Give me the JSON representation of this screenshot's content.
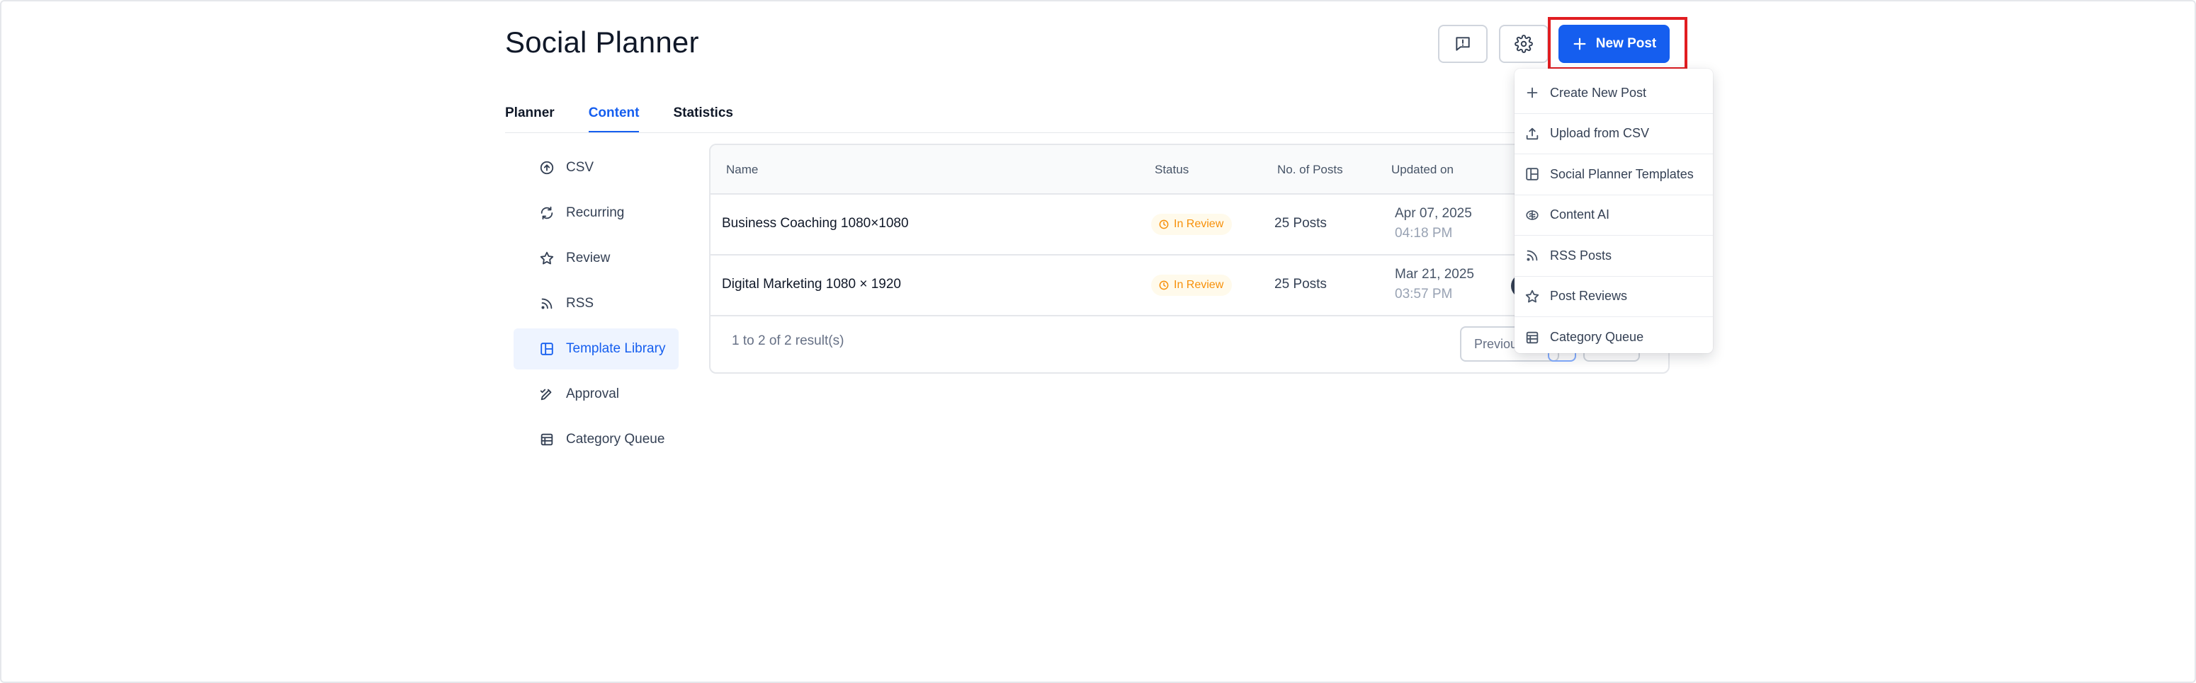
{
  "page": {
    "title": "Social Planner"
  },
  "header": {
    "new_post_label": "New Post"
  },
  "tabs": [
    {
      "label": "Planner"
    },
    {
      "label": "Content",
      "active": true
    },
    {
      "label": "Statistics"
    }
  ],
  "sidebar": {
    "items": [
      {
        "label": "CSV",
        "icon": "upload-circle-icon"
      },
      {
        "label": "Recurring",
        "icon": "refresh-icon"
      },
      {
        "label": "Review",
        "icon": "star-icon"
      },
      {
        "label": "RSS",
        "icon": "rss-icon"
      },
      {
        "label": "Template Library",
        "icon": "layout-icon",
        "active": true
      },
      {
        "label": "Approval",
        "icon": "pen-check-icon"
      },
      {
        "label": "Category Queue",
        "icon": "calendar-grid-icon"
      }
    ]
  },
  "table": {
    "columns": [
      "Name",
      "Status",
      "No. of Posts",
      "Updated on"
    ],
    "rows": [
      {
        "name": "Business Coaching 1080×1080",
        "status": "In Review",
        "posts": "25 Posts",
        "date": "Apr 07, 2025",
        "time": "04:18 PM"
      },
      {
        "name": "Digital Marketing 1080 × 1920",
        "status": "In Review",
        "posts": "25 Posts",
        "date": "Mar 21, 2025",
        "time": "03:57 PM"
      }
    ],
    "results_text": "1 to 2 of 2 result(s)",
    "previous_label": "Previous"
  },
  "dropdown": {
    "items": [
      {
        "label": "Create New Post",
        "icon": "plus-icon"
      },
      {
        "label": "Upload from CSV",
        "icon": "upload-icon"
      },
      {
        "label": "Social Planner Templates",
        "icon": "layout-icon"
      },
      {
        "label": "Content AI",
        "icon": "ai-brain-icon"
      },
      {
        "label": "RSS Posts",
        "icon": "rss-icon"
      },
      {
        "label": "Post Reviews",
        "icon": "star-icon"
      },
      {
        "label": "Category Queue",
        "icon": "calendar-grid-icon"
      }
    ]
  },
  "colors": {
    "accent": "#155eef",
    "badge_text": "#f79009",
    "badge_bg": "#fffaeb",
    "highlight": "#e11d21"
  }
}
